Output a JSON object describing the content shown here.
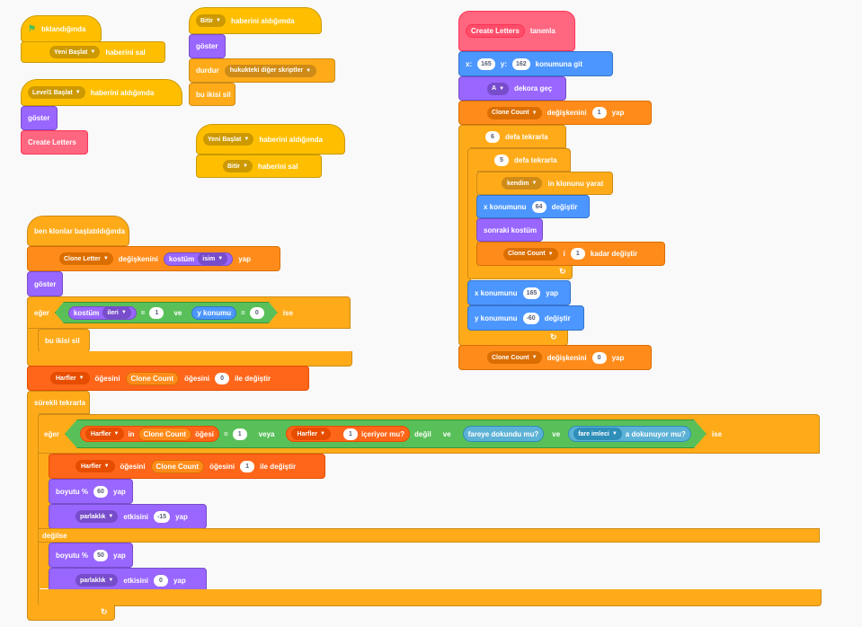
{
  "script1": {
    "hat": "tıklandığında",
    "broadcast_prefix": "Yeni Başlat",
    "broadcast_action": "haberini sal"
  },
  "script2": {
    "hat_msg": "Level1 Başlat",
    "hat_suffix": "haberini aldığımda",
    "show": "göster",
    "custom": "Create Letters"
  },
  "script3": {
    "hat_msg": "Bitir",
    "hat_suffix": "haberini aldığımda",
    "show": "göster",
    "stop_prefix": "durdur",
    "stop_opt": "hukukteki diğer skriptler",
    "hide": "bu ikisi sil"
  },
  "script4": {
    "hat_msg": "Yeni Başlat",
    "hat_suffix": "haberini aldığımda",
    "broadcast_msg": "Bitir",
    "broadcast_action": "haberini sal"
  },
  "script5": {
    "define": "tanımla",
    "custom": "Create Letters",
    "goto_x": "165",
    "goto_y_label": "y:",
    "goto_y": "162",
    "goto_suffix": "konumuna git",
    "costume": "A",
    "costume_suffix": "dekora geç",
    "set1_var": "Clone Count",
    "set1_mid": "değişkenini",
    "set1_val": "1",
    "set1_end": "yap",
    "repeat1_val": "6",
    "repeat1_label": "defa tekrarla",
    "repeat2_val": "5",
    "repeat2_label": "defa tekrarla",
    "clone_opt": "kendim",
    "clone_suffix": "in klonunu yarat",
    "changex_prefix": "x konumunu",
    "changex_val": "64",
    "changex_suffix": "değiştir",
    "next_costume": "sonraki kostüm",
    "change1_var": "Clone Count",
    "change1_mid": "i",
    "change1_val": "1",
    "change1_end": "kadar değiştir",
    "setx_prefix": "x konumunu",
    "setx_val": "165",
    "setx_suffix": "yap",
    "changey_prefix": "y konumunu",
    "changey_val": "-60",
    "changey_suffix": "değiştir",
    "set2_var": "Clone Count",
    "set2_mid": "değişkenini",
    "set2_val": "0",
    "set2_end": "yap"
  },
  "script6": {
    "hat": "ben klonlar başlatıldığında",
    "set_var": "Clone Letter",
    "set_mid": "değişkenini",
    "set_rep": "kostüm",
    "set_rep_opt": "isim",
    "set_end": "yap",
    "show": "göster",
    "if_label": "eğer",
    "if_rep": "kostüm",
    "if_rep_opt": "ileri",
    "eq": "=",
    "if_val1": "1",
    "and": "ve",
    "if_rep2": "y konumu",
    "eq2": "=",
    "if_val2": "0",
    "then": "ise",
    "delete": "bu ikisi sil",
    "list_prefix": "Harfler",
    "list_op": "öğesini",
    "list_var": "Clone Count",
    "list_mid": "öğesini",
    "list_val": "0",
    "list_end": "ile değiştir",
    "forever": "sürekli tekrarla",
    "if2_label": "eğer",
    "item_list": "Harfler",
    "item_mid": "in",
    "item_var": "Clone Count",
    "item_suffix": "öğesi",
    "eq3": "=",
    "item_val": "1",
    "or": "veya",
    "contains_list": "Harfler",
    "contains_val": "1",
    "contains_suffix": "içeriyor mu?",
    "not_label": "değil",
    "and2": "ve",
    "touch": "fareye dokundu mu?",
    "and3": "ve",
    "key_opt": "fare imleci",
    "key_suffix": "a dokunuyor mu?",
    "then2": "ise",
    "inner_list": "Harfler",
    "inner_op": "öğesini",
    "inner_var": "Clone Count",
    "inner_mid": "öğesini",
    "inner_val": "1",
    "inner_end": "ile değiştir",
    "size1_prefix": "boyutu %",
    "size1_val": "60",
    "size1_end": "yap",
    "effect1_opt": "parlaklık",
    "effect1_mid": "etkisini",
    "effect1_val": "-15",
    "effect1_end": "yap",
    "else": "değilse",
    "size2_prefix": "boyutu %",
    "size2_val": "50",
    "size2_end": "yap",
    "effect2_opt": "parlaklık",
    "effect2_mid": "etkisini",
    "effect2_val": "0",
    "effect2_end": "yap"
  }
}
